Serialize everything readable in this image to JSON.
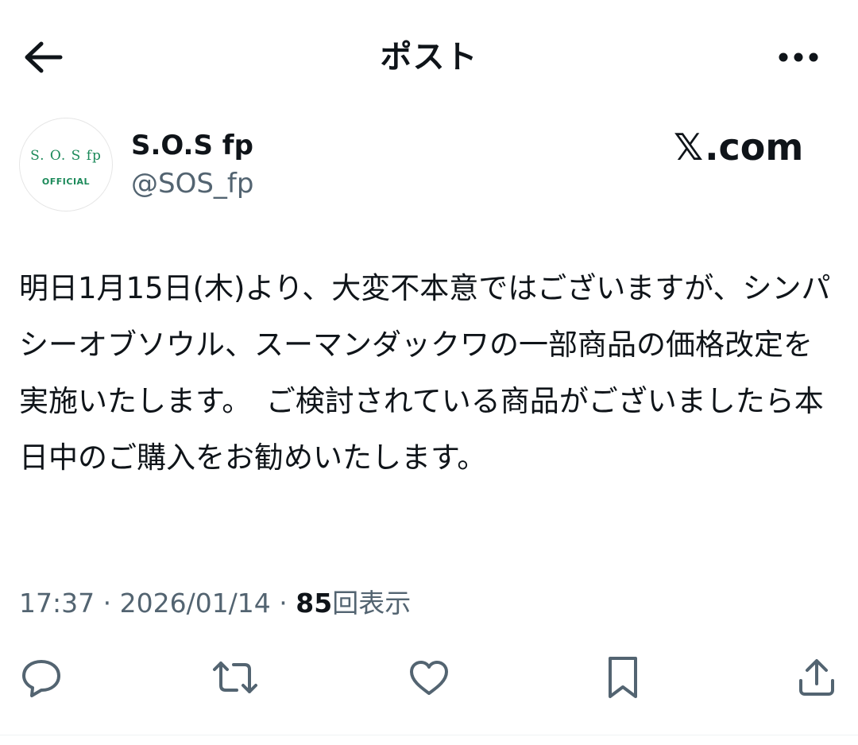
{
  "header": {
    "title": "ポスト",
    "back_icon": "arrow-left-icon",
    "more_icon": "more-horizontal-icon"
  },
  "author": {
    "avatar_line1": "S. O. S fp",
    "avatar_line2": "OFFICIAL",
    "display_name": "S.O.S fp",
    "handle": "@SOS_fp"
  },
  "watermark": {
    "x_glyph": "𝕏",
    "text": ".com"
  },
  "post": {
    "body": "明日1月15日(木)より、大変不本意ではございますが、シンパシーオブソウル、スーマンダックワの一部商品の価格改定を実施いたします。　ご検討されている商品がございましたら本日中のご購入をお勧めいたします。"
  },
  "meta": {
    "time": "17:37",
    "separator": " · ",
    "date": "2026/01/14",
    "views_count": "85",
    "views_label": "回表示"
  },
  "actions": [
    {
      "name": "reply",
      "icon": "reply-icon"
    },
    {
      "name": "repost",
      "icon": "repost-icon"
    },
    {
      "name": "like",
      "icon": "heart-icon"
    },
    {
      "name": "bookmark",
      "icon": "bookmark-icon"
    },
    {
      "name": "share",
      "icon": "share-icon"
    }
  ],
  "colors": {
    "text_primary": "#0f1419",
    "text_secondary": "#536471",
    "avatar_accent": "#1c8a5a"
  }
}
